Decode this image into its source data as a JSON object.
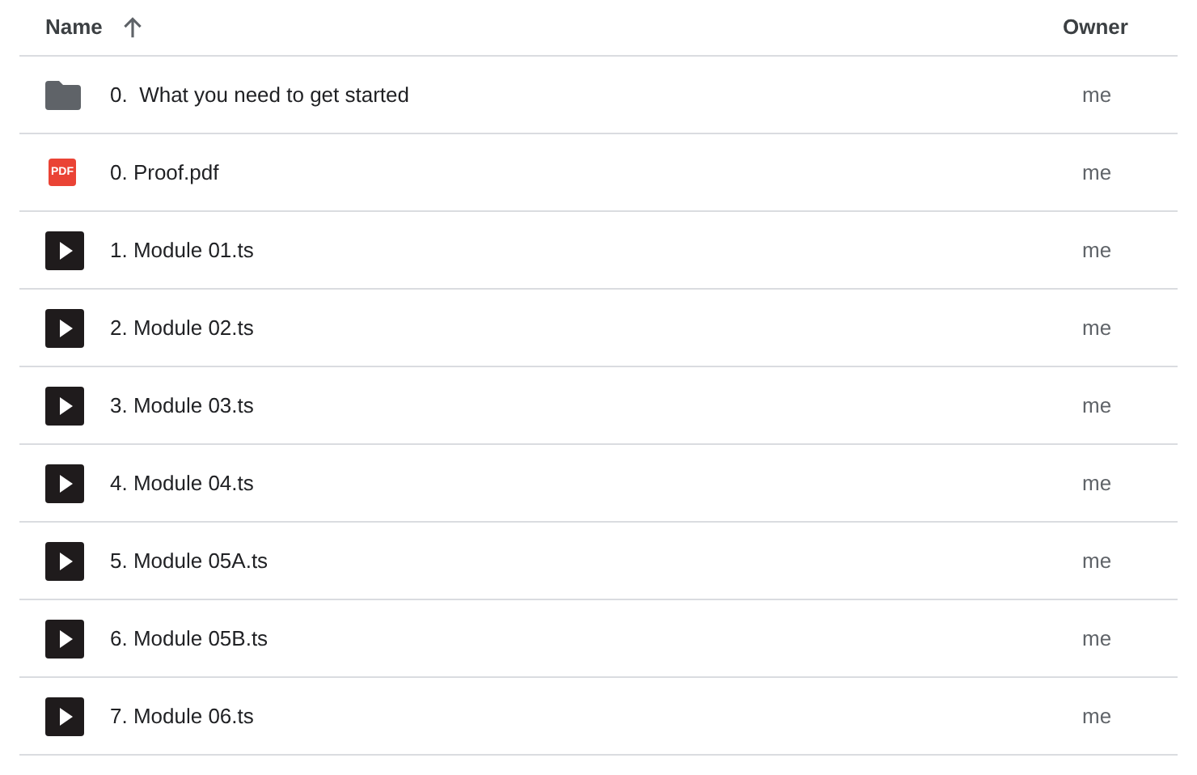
{
  "columns": [
    {
      "label": "Name",
      "sorted": true
    },
    {
      "label": "Owner",
      "sorted": false
    }
  ],
  "rows": [
    {
      "kind": "folder",
      "name": "0.  What you need to get started",
      "owner": "me"
    },
    {
      "kind": "pdf",
      "icon_label": "PDF",
      "name": "0. Proof.pdf",
      "owner": "me"
    },
    {
      "kind": "video",
      "name": "1. Module 01.ts",
      "owner": "me"
    },
    {
      "kind": "video",
      "name": "2. Module 02.ts",
      "owner": "me"
    },
    {
      "kind": "video",
      "name": "3. Module 03.ts",
      "owner": "me"
    },
    {
      "kind": "video",
      "name": "4. Module 04.ts",
      "owner": "me"
    },
    {
      "kind": "video",
      "name": "5. Module 05A.ts",
      "owner": "me"
    },
    {
      "kind": "video",
      "name": "6. Module 05B.ts",
      "owner": "me"
    },
    {
      "kind": "video",
      "name": "7. Module 06.ts",
      "owner": "me"
    }
  ]
}
